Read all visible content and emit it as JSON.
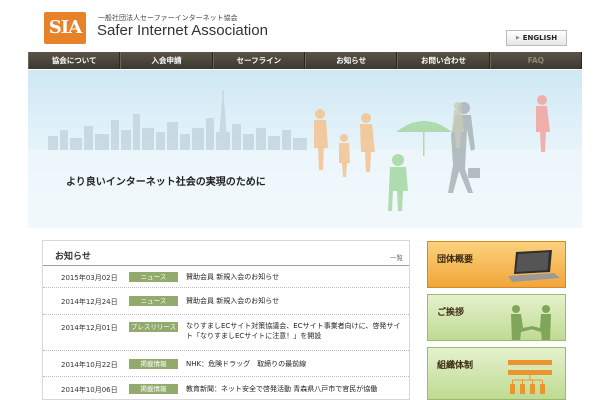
{
  "header": {
    "logo_mark": "SIA",
    "org_name_jp": "一般社団法人セーファーインターネット協会",
    "org_name_en": "Safer Internet Association",
    "lang_button": "ENGLISH"
  },
  "nav": {
    "items": [
      {
        "label": "協会について"
      },
      {
        "label": "入会申請"
      },
      {
        "label": "セーフライン"
      },
      {
        "label": "お知らせ"
      },
      {
        "label": "お問い合わせ"
      },
      {
        "label": "FAQ"
      }
    ]
  },
  "hero": {
    "tagline": "より良いインターネット社会の実現のために"
  },
  "news": {
    "title": "お知らせ",
    "more": "一覧",
    "items": [
      {
        "date": "2015年03月02日",
        "tag": "ニュース",
        "text": "賛助会員 新規入会のお知らせ"
      },
      {
        "date": "2014年12月24日",
        "tag": "ニュース",
        "text": "賛助会員 新規入会のお知らせ"
      },
      {
        "date": "2014年12月01日",
        "tag": "プレスリリース",
        "text": "なりすましECサイト対策協議会、ECサイト事業者向けに、啓発サイト「なりすましECサイトに注意！」を開設"
      },
      {
        "date": "2014年10月22日",
        "tag": "掲載情報",
        "text": "NHK：危険ドラッグ　取締りの最前線"
      },
      {
        "date": "2014年10月06日",
        "tag": "掲載情報",
        "text": "教育新聞：ネット安全で啓発活動 青森県八戸市で官民が協働"
      }
    ]
  },
  "sidebar": {
    "cards": [
      {
        "label": "団体概要"
      },
      {
        "label": "ご挨拶"
      },
      {
        "label": "組織体制"
      }
    ]
  }
}
